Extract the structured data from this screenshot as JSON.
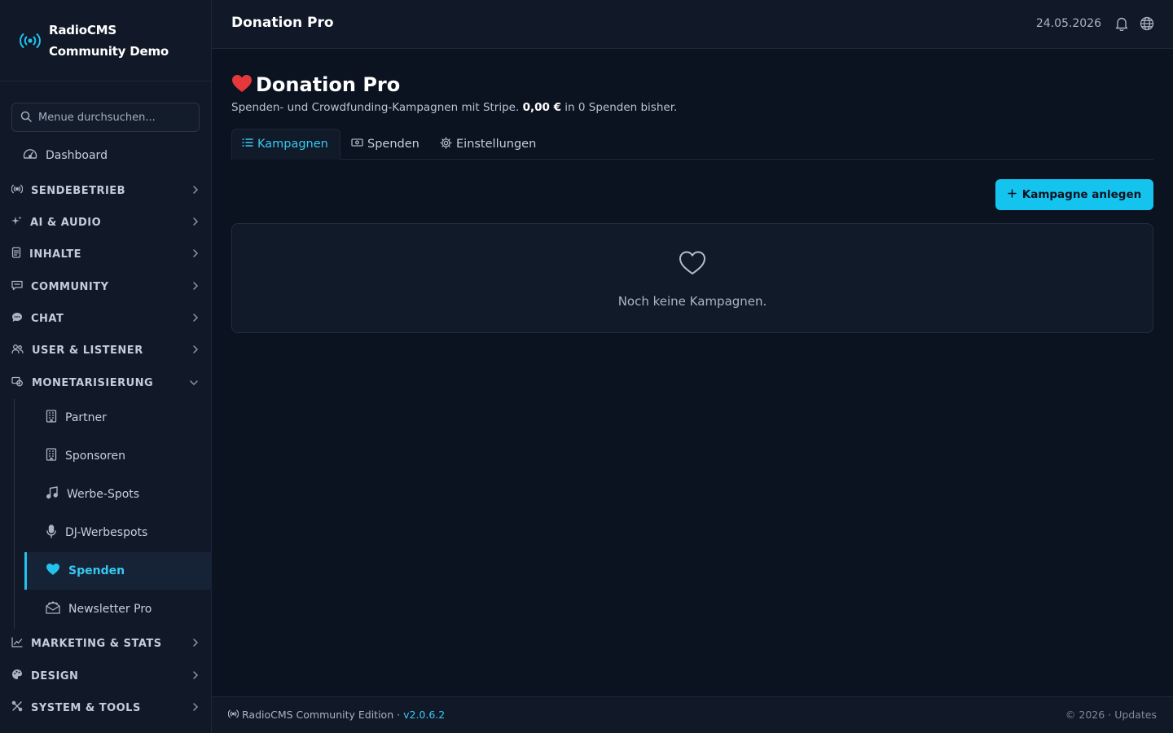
{
  "brand": {
    "line1": "RadioCMS",
    "line2": "Community Demo"
  },
  "sidebar": {
    "search_placeholder": "Menue durchsuchen...",
    "dashboard": "Dashboard",
    "sections": [
      {
        "label": "SENDEBETRIEB",
        "icon": "broadcast-icon"
      },
      {
        "label": "AI & AUDIO",
        "icon": "sparkle-icon"
      },
      {
        "label": "INHALTE",
        "icon": "document-icon"
      },
      {
        "label": "COMMUNITY",
        "icon": "message-square-icon"
      },
      {
        "label": "CHAT",
        "icon": "chat-bubble-icon"
      },
      {
        "label": "USER & LISTENER",
        "icon": "users-icon"
      },
      {
        "label": "MONETARISIERUNG",
        "icon": "money-icon",
        "expanded": true
      },
      {
        "label": "MARKETING & STATS",
        "icon": "chart-line-icon"
      },
      {
        "label": "DESIGN",
        "icon": "palette-icon"
      },
      {
        "label": "SYSTEM & TOOLS",
        "icon": "tools-icon"
      }
    ],
    "subitems": [
      {
        "label": "Partner",
        "icon": "building-icon"
      },
      {
        "label": "Sponsoren",
        "icon": "building-icon"
      },
      {
        "label": "Werbe-Spots",
        "icon": "music-note-icon"
      },
      {
        "label": "DJ-Werbespots",
        "icon": "microphone-icon"
      },
      {
        "label": "Spenden",
        "icon": "heart-icon",
        "active": true
      },
      {
        "label": "Newsletter Pro",
        "icon": "mail-open-icon"
      }
    ]
  },
  "topbar": {
    "title": "Donation Pro",
    "date": "24.05.2026"
  },
  "main": {
    "heading": "Donation Pro",
    "subtitle_prefix": "Spenden- und Crowdfunding-Kampagnen mit Stripe. ",
    "subtitle_amount": "0,00 €",
    "subtitle_suffix": " in 0 Spenden bisher.",
    "tabs": [
      {
        "label": "Kampagnen",
        "active": true
      },
      {
        "label": "Spenden"
      },
      {
        "label": "Einstellungen"
      }
    ],
    "add_button": "Kampagne anlegen",
    "empty_message": "Noch keine Kampagnen."
  },
  "footer": {
    "product": "RadioCMS Community Edition",
    "separator": "·",
    "version": "v2.0.6.2",
    "copyright": "© 2026",
    "updates": "Updates"
  },
  "colors": {
    "accent": "#22c1ee",
    "background": "#0b1220",
    "sidebar": "#111827",
    "heart_red": "#e5383b"
  }
}
